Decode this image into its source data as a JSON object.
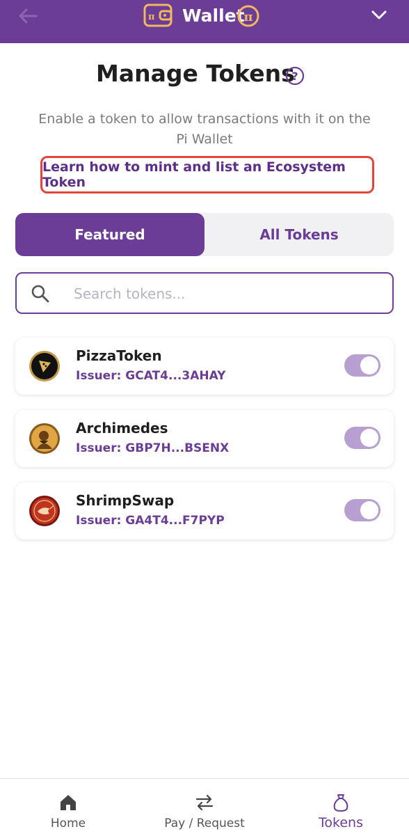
{
  "header": {
    "title": "Wallet",
    "back_icon": "arrow-left-icon",
    "menu_icon": "chevron-down-icon"
  },
  "page": {
    "title": "Manage Tokens",
    "help_icon": "question-circle-icon",
    "subtitle": "Enable a token to allow transactions with it on the Pi Wallet",
    "learn_link": "Learn how to mint and list an Ecosystem Token"
  },
  "tabs": [
    {
      "label": "Featured",
      "active": true
    },
    {
      "label": "All Tokens",
      "active": false
    }
  ],
  "search": {
    "placeholder": "Search tokens...",
    "value": ""
  },
  "tokens": [
    {
      "name": "PizzaToken",
      "issuer": "Issuer: GCAT4...3AHAY",
      "icon": "pizza-icon",
      "enabled": true
    },
    {
      "name": "Archimedes",
      "issuer": "Issuer: GBP7H...BSENX",
      "icon": "archimedes-portrait-icon",
      "enabled": true
    },
    {
      "name": "ShrimpSwap",
      "issuer": "Issuer: GA4T4...F7PYP",
      "icon": "shrimp-icon",
      "enabled": true
    }
  ],
  "bottom_nav": [
    {
      "label": "Home",
      "icon": "home-icon",
      "active": false
    },
    {
      "label": "Pay / Request",
      "icon": "transfer-arrows-icon",
      "active": false
    },
    {
      "label": "Tokens",
      "icon": "token-bag-icon",
      "active": true
    }
  ],
  "colors": {
    "brand_purple": "#6b3d96",
    "highlight_red": "#e3453d",
    "toggle_on": "#b79fd2",
    "gold": "#f2b860"
  }
}
